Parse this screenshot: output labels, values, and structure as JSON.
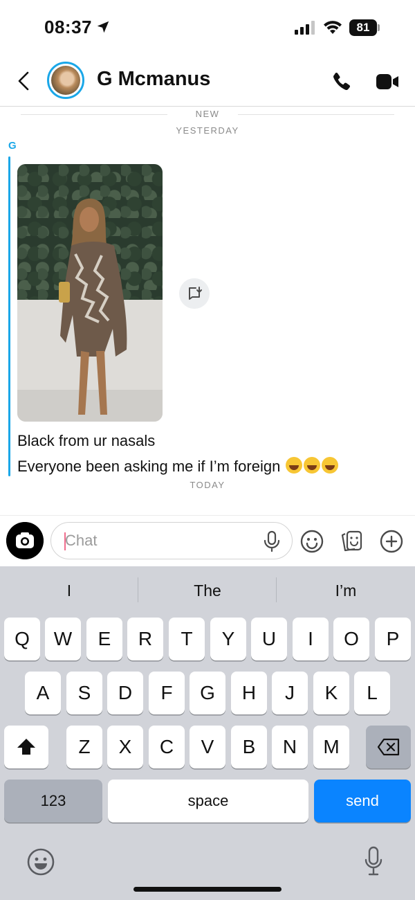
{
  "status_bar": {
    "time": "08:37",
    "battery": "81",
    "icons": [
      "location-arrow-icon",
      "cellular-signal-icon",
      "wifi-icon",
      "battery-icon"
    ]
  },
  "header": {
    "contact_name": "G Mcmanus",
    "icons": [
      "back-chevron-icon",
      "avatar",
      "phone-icon",
      "video-camera-icon"
    ]
  },
  "conversation": {
    "new_label": "NEW",
    "yesterday_label": "YESTERDAY",
    "sender_initial": "G",
    "messages": [
      {
        "type": "image",
        "description_icon": "save-to-chat-icon"
      },
      {
        "type": "text",
        "text": "Black from ur nasals"
      },
      {
        "type": "text",
        "text": "Everyone been asking me if I’m foreign",
        "emoji_count": 3
      }
    ],
    "today_label": "TODAY"
  },
  "chat_bar": {
    "placeholder": "Chat",
    "icons": [
      "camera-icon",
      "mic-icon",
      "emoji-icon",
      "sticker-icon",
      "plus-icon"
    ]
  },
  "keyboard": {
    "suggestions": [
      "I",
      "The",
      "I’m"
    ],
    "row1": [
      "Q",
      "W",
      "E",
      "R",
      "T",
      "Y",
      "U",
      "I",
      "O",
      "P"
    ],
    "row2": [
      "A",
      "S",
      "D",
      "F",
      "G",
      "H",
      "J",
      "K",
      "L"
    ],
    "row3": [
      "Z",
      "X",
      "C",
      "V",
      "B",
      "N",
      "M"
    ],
    "numbers_label": "123",
    "space_label": "space",
    "send_label": "send"
  },
  "colors": {
    "accent": "#1aa7e8",
    "send": "#0a84ff",
    "keyboard_bg": "#d1d3d9"
  }
}
